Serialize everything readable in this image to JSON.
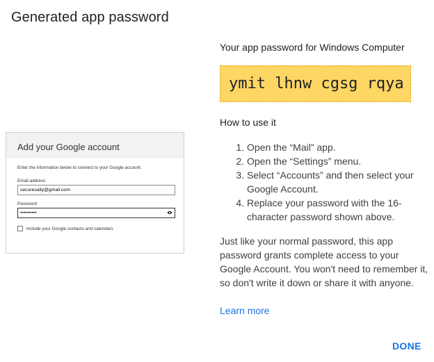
{
  "dialog": {
    "title": "Generated app password",
    "password_heading": "Your app password for Windows Computer",
    "password": "ymit lhnw cgsg rqya",
    "howto_heading": "How to use it",
    "steps": [
      "Open the “Mail” app.",
      "Open the “Settings” menu.",
      "Select “Accounts” and then select your Google Account.",
      "Replace your password with the 16-character password shown above."
    ],
    "paragraph": "Just like your normal password, this app password grants complete access to your Google Account. You won't need to remember it, so don't write it down or share it with anyone.",
    "learn_more": "Learn more",
    "done_label": "DONE",
    "colors": {
      "accent": "#1a73e8",
      "password_bg": "#fdd663"
    }
  },
  "preview": {
    "header": "Add your Google account",
    "intro": "Enter the information below to connect to your Google account.",
    "email_label": "Email address",
    "email_value": "securesally@gmail.com",
    "password_label": "Password",
    "password_value": "••••••••••",
    "checkbox_label": "Include your Google contacts and calendars",
    "eye_icon": "eye-icon"
  }
}
